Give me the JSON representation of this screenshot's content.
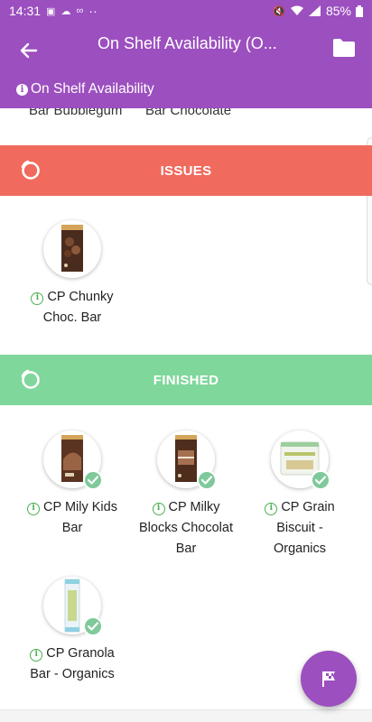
{
  "status_bar": {
    "time": "14:31",
    "battery": "85%",
    "dots": "··"
  },
  "app_bar": {
    "title": "On Shelf Availability (O...",
    "subtitle": "On Shelf Availability"
  },
  "previous_row": {
    "item_1": "Bar Bubblegum",
    "item_2": "Bar Chocolate"
  },
  "sections": {
    "issues": {
      "label": "ISSUES",
      "items": [
        {
          "line1": "CP Chunky",
          "line2": "Choc. Bar",
          "line3": ""
        }
      ]
    },
    "finished": {
      "label": "FINISHED",
      "items": [
        {
          "line1": "CP Mily Kids",
          "line2": "Bar",
          "line3": ""
        },
        {
          "line1": "CP Milky",
          "line2": "Blocks Chocolat",
          "line3": "Bar"
        },
        {
          "line1": "CP Grain",
          "line2": "Biscuit -",
          "line3": "Organics"
        },
        {
          "line1": "CP Granola",
          "line2": "Bar - Organics",
          "line3": ""
        }
      ]
    }
  },
  "colors": {
    "primary": "#9c4fbf",
    "issues": "#f06a5d",
    "finished": "#7fd79b",
    "info": "#4caf50",
    "check": "#7fc99a"
  },
  "icons": [
    "back-arrow-icon",
    "folder-icon",
    "info-icon",
    "spinner-icon",
    "check-icon",
    "flag-icon"
  ]
}
